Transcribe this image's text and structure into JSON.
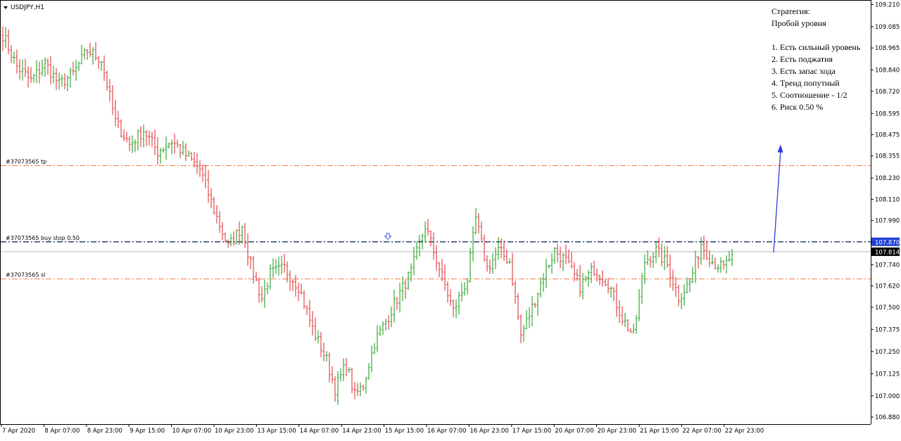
{
  "chart_data": {
    "type": "candlestick",
    "symbol_timeframe": "USDJPY,H1",
    "y_ticks": [
      "109.210",
      "109.085",
      "108.965",
      "108.840",
      "108.720",
      "108.595",
      "108.475",
      "108.355",
      "108.230",
      "108.110",
      "107.990",
      "107.870",
      "107.740",
      "107.620",
      "107.500",
      "107.375",
      "107.250",
      "107.125",
      "107.000",
      "106.880"
    ],
    "x_ticks": [
      "7 Apr 2020",
      "8 Apr 07:00",
      "8 Apr 23:00",
      "9 Apr 15:00",
      "10 Apr 07:00",
      "10 Apr 23:00",
      "13 Apr 15:00",
      "14 Apr 07:00",
      "14 Apr 23:00",
      "15 Apr 15:00",
      "16 Apr 07:00",
      "16 Apr 23:00",
      "17 Apr 15:00",
      "20 Apr 07:00",
      "20 Apr 23:00",
      "21 Apr 15:00",
      "22 Apr 07:00",
      "22 Apr 23:00"
    ],
    "ylim": [
      106.86,
      109.22
    ],
    "up_color": "#22a022",
    "down_color": "#e0393b",
    "waypoints": [
      [
        0,
        109.04
      ],
      [
        5,
        108.86
      ],
      [
        10,
        108.78
      ],
      [
        15,
        108.88
      ],
      [
        20,
        108.76
      ],
      [
        25,
        108.82
      ],
      [
        30,
        108.95
      ],
      [
        35,
        108.9
      ],
      [
        40,
        108.55
      ],
      [
        45,
        108.42
      ],
      [
        50,
        108.5
      ],
      [
        55,
        108.38
      ],
      [
        60,
        108.44
      ],
      [
        65,
        108.36
      ],
      [
        70,
        108.28
      ],
      [
        75,
        108.05
      ],
      [
        80,
        107.84
      ],
      [
        85,
        107.96
      ],
      [
        88,
        107.74
      ],
      [
        92,
        107.55
      ],
      [
        95,
        107.69
      ],
      [
        100,
        107.72
      ],
      [
        105,
        107.62
      ],
      [
        110,
        107.38
      ],
      [
        115,
        107.2
      ],
      [
        118,
        107.04
      ],
      [
        122,
        107.18
      ],
      [
        125,
        107.0
      ],
      [
        128,
        107.06
      ],
      [
        132,
        107.3
      ],
      [
        136,
        107.42
      ],
      [
        140,
        107.55
      ],
      [
        145,
        107.7
      ],
      [
        150,
        107.96
      ],
      [
        155,
        107.72
      ],
      [
        160,
        107.48
      ],
      [
        165,
        107.66
      ],
      [
        168,
        108.0
      ],
      [
        172,
        107.72
      ],
      [
        176,
        107.82
      ],
      [
        180,
        107.76
      ],
      [
        184,
        107.34
      ],
      [
        188,
        107.5
      ],
      [
        192,
        107.68
      ],
      [
        196,
        107.82
      ],
      [
        200,
        107.76
      ],
      [
        205,
        107.62
      ],
      [
        210,
        107.72
      ],
      [
        215,
        107.64
      ],
      [
        220,
        107.44
      ],
      [
        224,
        107.34
      ],
      [
        228,
        107.76
      ],
      [
        232,
        107.82
      ],
      [
        236,
        107.74
      ],
      [
        240,
        107.56
      ],
      [
        244,
        107.64
      ],
      [
        248,
        107.86
      ],
      [
        252,
        107.76
      ],
      [
        256,
        107.72
      ],
      [
        259,
        107.8
      ]
    ],
    "hlines": [
      {
        "label": "#37073565 tp",
        "price": 108.3,
        "color": "#f47b45",
        "style": "dashdot"
      },
      {
        "label": "#37073565 buy stop 0.50",
        "price": 107.87,
        "color": "#1b2f6a",
        "style": "dashdot"
      },
      {
        "label": "#37073565 sl",
        "price": 107.66,
        "color": "#f47b45",
        "style": "dashdot"
      }
    ],
    "current_price": {
      "label": "107.814",
      "price": 107.814
    },
    "order_price": {
      "label": "107.870",
      "price": 107.87,
      "color": "#1f3fd6"
    },
    "arrow": {
      "color": "#2e3dd6"
    },
    "strategy_note": {
      "title": "Стратегия:",
      "subtitle": "Пробой уровня",
      "items": [
        "1. Есть сильный уровень",
        "2. Есть поджатия",
        "3. Есть запас хода",
        "4. Тренд попутный",
        "5. Соотношение - 1/2",
        "6. Риск 0.50 %"
      ]
    }
  }
}
